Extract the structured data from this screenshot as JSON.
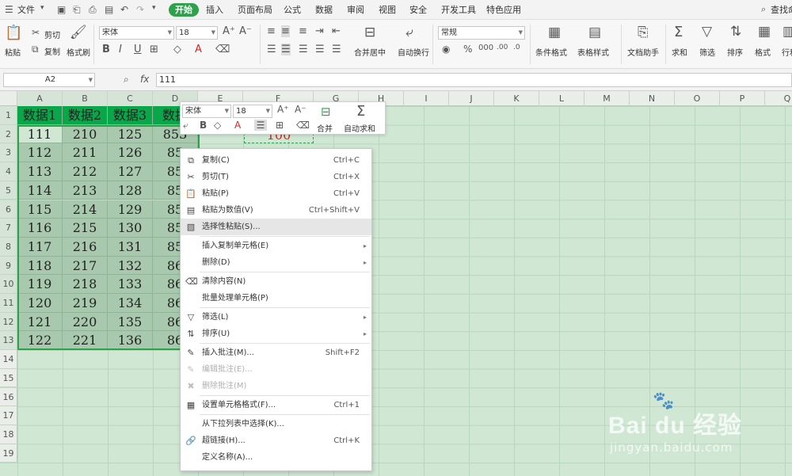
{
  "menubar": {
    "file_label": "文件",
    "tabs": [
      "开始",
      "插入",
      "页面布局",
      "公式",
      "数据",
      "审阅",
      "视图",
      "安全",
      "开发工具",
      "特色应用"
    ],
    "active_tab": "开始",
    "search_label": "查找命"
  },
  "ribbon": {
    "paste": "粘贴",
    "cut": "剪切",
    "copy": "复制",
    "format_painter": "格式刷",
    "font_name": "宋体",
    "font_size": "18",
    "merge_center": "合并居中",
    "auto_wrap": "自动换行",
    "number_format": "常规",
    "cond_format": "条件格式",
    "table_style": "表格样式",
    "doc_helper": "文档助手",
    "sum": "求和",
    "filter": "筛选",
    "sort": "排序",
    "format": "格式",
    "row_col": "行和"
  },
  "formula_bar": {
    "name_box": "A2",
    "fx_label": "fx",
    "value": "111"
  },
  "columns": [
    "A",
    "B",
    "C",
    "D",
    "E",
    "F",
    "G",
    "H",
    "I",
    "J",
    "K",
    "L",
    "M",
    "N",
    "O",
    "P",
    "Q"
  ],
  "rows": [
    "1",
    "2",
    "3",
    "4",
    "5",
    "6",
    "7",
    "8",
    "9",
    "10",
    "11",
    "12",
    "13",
    "14",
    "15",
    "16",
    "17",
    "18",
    "19"
  ],
  "sheet": {
    "headers": [
      "数据1",
      "数据2",
      "数据3",
      "数据"
    ],
    "col_a": [
      "111",
      "112",
      "113",
      "114",
      "115",
      "116",
      "117",
      "118",
      "119",
      "120",
      "121",
      "122"
    ],
    "col_b": [
      "210",
      "211",
      "212",
      "213",
      "214",
      "215",
      "216",
      "217",
      "218",
      "219",
      "220",
      "221"
    ],
    "col_c": [
      "125",
      "126",
      "127",
      "128",
      "129",
      "130",
      "131",
      "132",
      "133",
      "134",
      "135",
      "136"
    ],
    "col_d": [
      "853",
      "85",
      "85",
      "85",
      "85",
      "85",
      "85",
      "86",
      "86",
      "86",
      "86",
      "86"
    ],
    "f2_value": "100"
  },
  "mini_toolbar": {
    "font_name": "宋体",
    "font_size": "18",
    "merge": "合并",
    "auto_sum": "自动求和"
  },
  "context_menu": [
    {
      "icon": "copy-icon",
      "glyph": "⧉",
      "label": "复制(C)",
      "shortcut": "Ctrl+C",
      "sub": false,
      "disabled": false
    },
    {
      "icon": "cut-icon",
      "glyph": "✂",
      "label": "剪切(T)",
      "shortcut": "Ctrl+X",
      "sub": false,
      "disabled": false
    },
    {
      "icon": "paste-icon",
      "glyph": "📋",
      "label": "粘贴(P)",
      "shortcut": "Ctrl+V",
      "sub": false,
      "disabled": false
    },
    {
      "icon": "paste-values-icon",
      "glyph": "▤",
      "label": "粘贴为数值(V)",
      "shortcut": "Ctrl+Shift+V",
      "sub": false,
      "disabled": false
    },
    {
      "icon": "paste-special-icon",
      "glyph": "▧",
      "label": "选择性粘贴(S)...",
      "shortcut": "",
      "sub": false,
      "disabled": false,
      "highlight": true
    },
    {
      "icon": "",
      "glyph": "",
      "label": "插入复制单元格(E)",
      "shortcut": "",
      "sub": true,
      "disabled": false
    },
    {
      "icon": "",
      "glyph": "",
      "label": "删除(D)",
      "shortcut": "",
      "sub": true,
      "disabled": false
    },
    {
      "icon": "clear-icon",
      "glyph": "⌫",
      "label": "清除内容(N)",
      "shortcut": "",
      "sub": false,
      "disabled": false
    },
    {
      "icon": "",
      "glyph": "",
      "label": "批量处理单元格(P)",
      "shortcut": "",
      "sub": false,
      "disabled": false
    },
    {
      "icon": "filter-icon",
      "glyph": "▽",
      "label": "筛选(L)",
      "shortcut": "",
      "sub": true,
      "disabled": false
    },
    {
      "icon": "sort-icon",
      "glyph": "⇅",
      "label": "排序(U)",
      "shortcut": "",
      "sub": true,
      "disabled": false
    },
    {
      "icon": "insert-comment-icon",
      "glyph": "✎",
      "label": "插入批注(M)...",
      "shortcut": "Shift+F2",
      "sub": false,
      "disabled": false
    },
    {
      "icon": "edit-comment-icon",
      "glyph": "✎",
      "label": "编辑批注(E)...",
      "shortcut": "",
      "sub": false,
      "disabled": true
    },
    {
      "icon": "delete-comment-icon",
      "glyph": "✖",
      "label": "删除批注(M)",
      "shortcut": "",
      "sub": false,
      "disabled": true
    },
    {
      "icon": "format-cells-icon",
      "glyph": "▦",
      "label": "设置单元格格式(F)...",
      "shortcut": "Ctrl+1",
      "sub": false,
      "disabled": false
    },
    {
      "icon": "",
      "glyph": "",
      "label": "从下拉列表中选择(K)...",
      "shortcut": "",
      "sub": false,
      "disabled": false
    },
    {
      "icon": "hyperlink-icon",
      "glyph": "🔗",
      "label": "超链接(H)...",
      "shortcut": "Ctrl+K",
      "sub": false,
      "disabled": false
    },
    {
      "icon": "",
      "glyph": "",
      "label": "定义名称(A)...",
      "shortcut": "",
      "sub": false,
      "disabled": false
    }
  ],
  "watermark": {
    "brand": "Bai du 经验",
    "url": "jingyan.baidu.com"
  },
  "colors": {
    "accent": "#2fa04b",
    "header_fill": "#0aa64a",
    "selection_fill": "#a8c9ad",
    "sheet_bg": "#cfe7d3",
    "red_text": "#e02020"
  }
}
